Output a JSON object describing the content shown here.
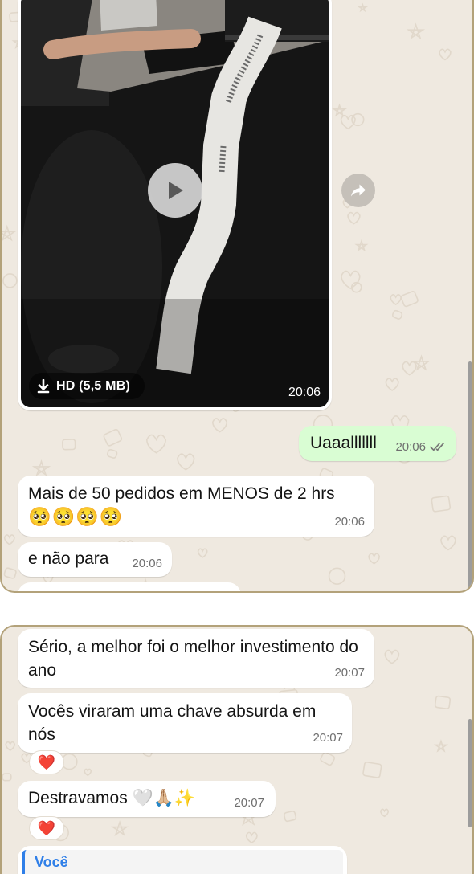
{
  "colors": {
    "border": "#b3a27a",
    "wallpaper": "#efe9e0",
    "bubble_out": "#d9fdd3",
    "bubble_in": "#ffffff",
    "heart": "#e3242b",
    "reply_accent": "#2f7fe8",
    "time_text": "#6f6f6f"
  },
  "icons": {
    "video_play": "play-icon",
    "download": "download-icon",
    "forward": "forward-icon",
    "read_status": "double-check-icon"
  },
  "chat": {
    "panel_top": {
      "video": {
        "hd_label": "HD (5,5 MB)",
        "time": "20:06"
      },
      "outgoing": {
        "text": "Uaaalllllll",
        "time": "20:06"
      },
      "incoming": [
        {
          "text": "Mais de 50 pedidos em MENOS de 2 hrs",
          "emoji_line": "🥺🥺🥺🥺",
          "time": "20:06"
        },
        {
          "text": "e não para",
          "time": "20:06"
        }
      ]
    },
    "panel_bottom": {
      "messages": [
        {
          "text": "Sério, a melhor foi o melhor investimento do ano",
          "time": "20:07"
        },
        {
          "text": "Vocês viraram uma chave absurda em nós",
          "time": "20:07",
          "reaction": "❤️"
        },
        {
          "text": "Destravamos 🤍🙏🏼✨",
          "time": "20:07",
          "reaction": "❤️"
        }
      ],
      "reply_preview": {
        "sender": "Você"
      }
    }
  }
}
